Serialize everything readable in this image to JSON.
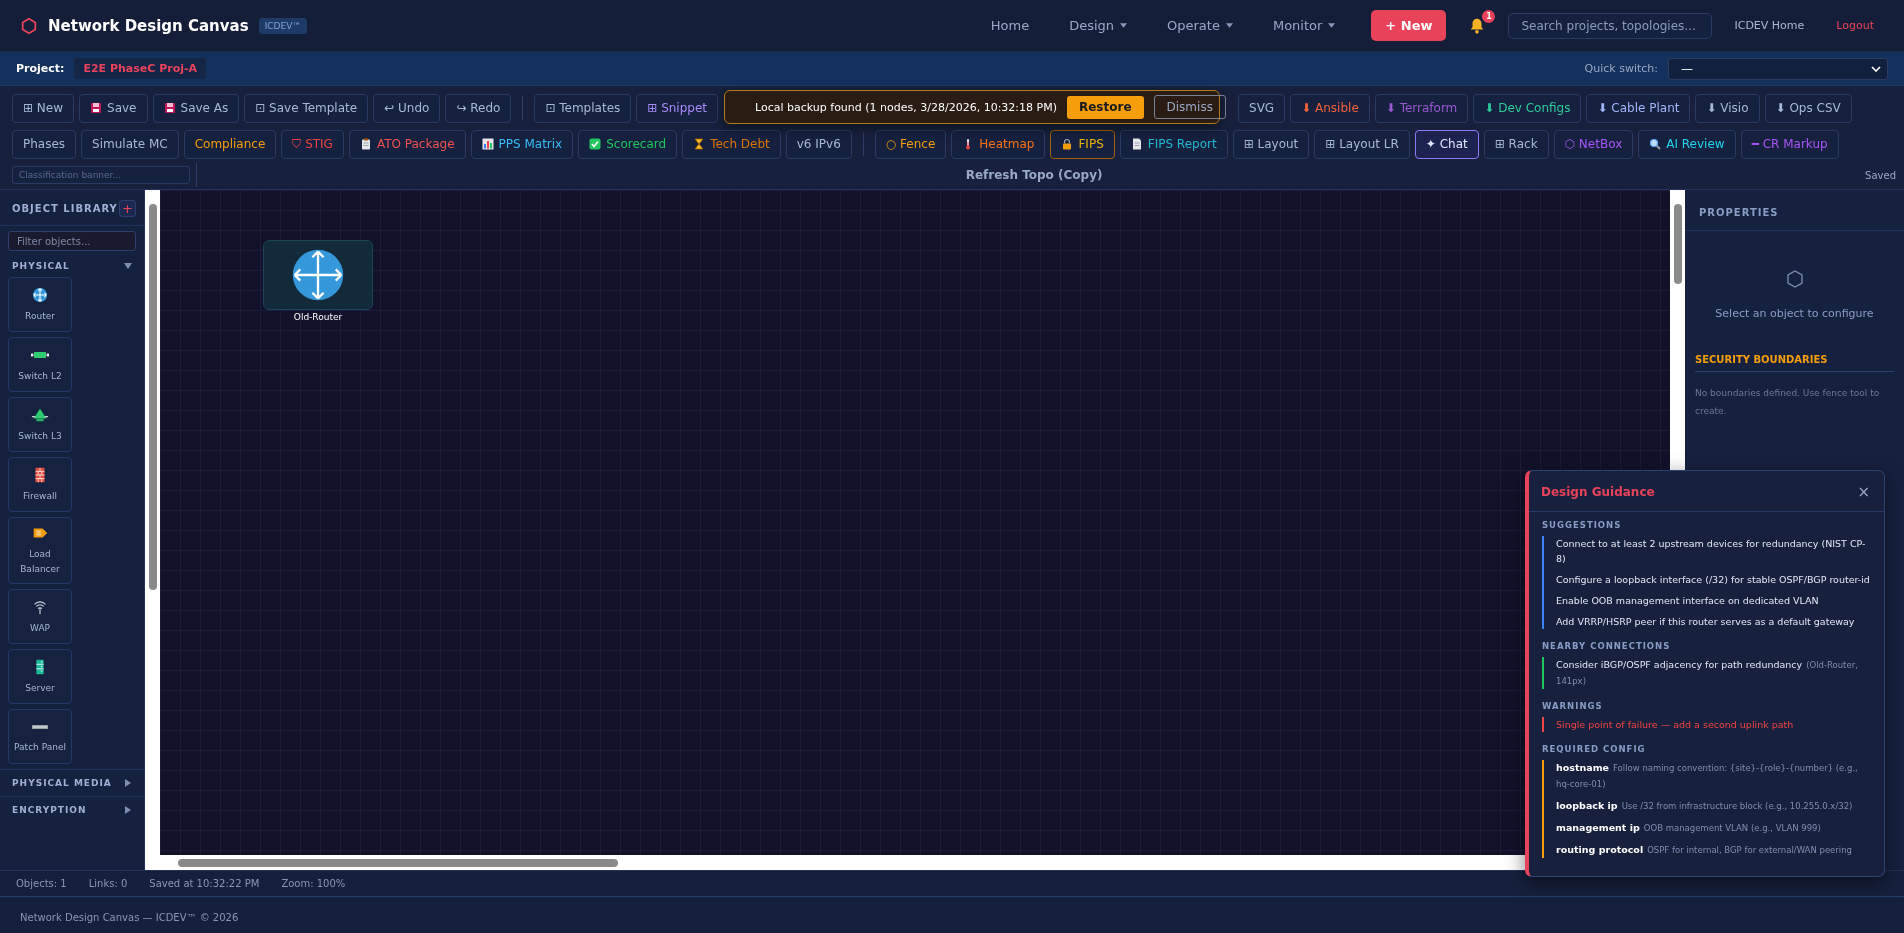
{
  "nav": {
    "logo_text": "Network Design Canvas",
    "badge": "ICDEV™",
    "menu": [
      {
        "label": "Home",
        "dropdown": false
      },
      {
        "label": "Design",
        "dropdown": true
      },
      {
        "label": "Operate",
        "dropdown": true
      },
      {
        "label": "Monitor",
        "dropdown": true
      }
    ],
    "new_button": "+ New",
    "notifications": "1",
    "search": {
      "placeholder": "Search projects, topologies..."
    },
    "home_link": "ICDEV Home",
    "logout": "Logout"
  },
  "project_bar": {
    "label": "Project:",
    "project": "E2E PhaseC Proj-A",
    "quick_switch_label": "Quick switch:",
    "quick_switch_value": "—"
  },
  "toolbar": {
    "rows": [
      {
        "groups": [
          [
            {
              "label": "⊞ New",
              "color": "#a9b8d6"
            },
            {
              "label": "Save",
              "kind": "disk",
              "color": "#a9b8d6"
            },
            {
              "label": "Save As",
              "kind": "disk",
              "color": "#a9b8d6"
            },
            {
              "label": "⊡ Save Template",
              "color": "#a9b8d6"
            },
            {
              "label": "↩ Undo",
              "color": "#a9b8d6"
            },
            {
              "label": "↪ Redo",
              "color": "#a9b8d6"
            }
          ],
          [
            {
              "label": "⊡ Templates",
              "color": "#a9b8d6"
            },
            {
              "label": "⊞ Snippet",
              "color": "#a78bfa"
            },
            {
              "kind": "hidden"
            },
            {
              "label": "SVG",
              "color": "#a9b8d6"
            },
            {
              "label": "⬇ Ansible",
              "color": "#f4623a"
            },
            {
              "label": "⬇ Terraform",
              "color": "#9b59d0"
            },
            {
              "label": "⬇ Dev Configs",
              "color": "#2ecc9a"
            },
            {
              "label": "⬇ Cable Plant",
              "color": "#a5b4fc"
            },
            {
              "label": "⬇ Visio",
              "color": "#a9b8d6"
            },
            {
              "label": "⬇ Ops CSV",
              "color": "#a9b8d6"
            }
          ]
        ]
      },
      {
        "groups": [
          [
            {
              "label": "Phases",
              "color": "#a9b8d6"
            },
            {
              "label": "Simulate MC",
              "color": "#a9b8d6"
            },
            {
              "label": "Compliance",
              "color": "#f59e0b"
            },
            {
              "label": "⛉ STIG",
              "color": "#ef4444"
            },
            {
              "label": "ATO Package",
              "kind": "clipboard",
              "color": "#f05252"
            },
            {
              "label": "PPS Matrix",
              "kind": "chart",
              "color": "#38bdf8"
            },
            {
              "label": "Scorecard",
              "kind": "check",
              "color": "#22c55e"
            },
            {
              "label": "Tech Debt",
              "kind": "hourglass",
              "color": "#d97706"
            },
            {
              "label": "v6 IPv6",
              "color": "#a9b8d6"
            }
          ],
          [
            {
              "label": "○ Fence",
              "color": "#f59e0b"
            },
            {
              "label": "Heatmap",
              "kind": "thermometer",
              "color": "#f97316"
            },
            {
              "label": "FIPS",
              "kind": "lock",
              "color": "#eab308",
              "highlight": true
            },
            {
              "label": "FIPS Report",
              "kind": "document",
              "color": "#22b8cf"
            },
            {
              "label": "⊞ Layout",
              "color": "#a9b8d6"
            },
            {
              "label": "⊞ Layout LR",
              "color": "#a9b8d6"
            },
            {
              "label": "✦ Chat",
              "color": "#e0e7ff",
              "selected": true
            },
            {
              "label": "⊞ Rack",
              "color": "#a9b8d6"
            },
            {
              "label": "⬡ NetBox",
              "color": "#a855f7"
            },
            {
              "label": "AI Review",
              "kind": "search",
              "color": "#22d3ee"
            },
            {
              "label": "━ CR Markup",
              "color": "#a855f7"
            }
          ]
        ]
      }
    ],
    "classification": {
      "placeholder": "Classification banner..."
    },
    "title": "Refresh Topo (Copy)",
    "save_state": "Saved"
  },
  "toast": {
    "message": "Local backup found (1 nodes, 3/28/2026, 10:32:18 PM)",
    "restore": "Restore",
    "dismiss": "Dismiss"
  },
  "library": {
    "title": "OBJECT LIBRARY",
    "add": "+",
    "filter": {
      "placeholder": "Filter objects..."
    },
    "sections": [
      {
        "title": "PHYSICAL",
        "expanded": true,
        "items": [
          {
            "label": "Router",
            "kind": "router"
          },
          {
            "label": "Switch L2",
            "kind": "switch2"
          },
          {
            "label": "Switch L3",
            "kind": "switch3"
          },
          {
            "label": "Firewall",
            "kind": "firewall"
          },
          {
            "label": "Load Balancer",
            "kind": "balancer"
          },
          {
            "label": "WAP",
            "kind": "wap"
          },
          {
            "label": "Server",
            "kind": "server"
          },
          {
            "label": "Patch Panel",
            "kind": "patch"
          }
        ]
      },
      {
        "title": "PHYSICAL MEDIA",
        "expanded": false
      },
      {
        "title": "ENCRYPTION",
        "expanded": false
      }
    ]
  },
  "canvas": {
    "nodes": [
      {
        "label": "Old-Router",
        "kind": "router"
      }
    ]
  },
  "properties": {
    "title": "PROPERTIES",
    "empty": "Select an object to configure",
    "boundaries_title": "SECURITY BOUNDARIES",
    "boundaries_empty": "No boundaries defined. Use fence tool to create."
  },
  "guidance": {
    "title": "Design Guidance",
    "close": "×",
    "sections": [
      {
        "title": "SUGGESTIONS",
        "kind": "suggestion",
        "items": [
          {
            "text": "Connect to at least 2 upstream devices for redundancy (NIST CP-8)"
          },
          {
            "text": "Configure a loopback interface (/32) for stable OSPF/BGP router-id"
          },
          {
            "text": "Enable OOB management interface on dedicated VLAN"
          },
          {
            "text": "Add VRRP/HSRP peer if this router serves as a default gateway"
          }
        ]
      },
      {
        "title": "NEARBY CONNECTIONS",
        "kind": "connection",
        "items": [
          {
            "text": "Consider iBGP/OSPF adjacency for path redundancy",
            "note": "(Old-Router, 141px)"
          }
        ]
      },
      {
        "title": "WARNINGS",
        "kind": "warning",
        "items": [
          {
            "text": "Single point of failure — add a second uplink path"
          }
        ]
      },
      {
        "title": "REQUIRED CONFIG",
        "kind": "config",
        "items": [
          {
            "key": "hostname",
            "note": "Follow naming convention: {site}-{role}-{number} (e.g., hq-core-01)"
          },
          {
            "key": "loopback ip",
            "note": "Use /32 from infrastructure block (e.g., 10.255.0.x/32)"
          },
          {
            "key": "management ip",
            "note": "OOB management VLAN (e.g., VLAN 999)"
          },
          {
            "key": "routing protocol",
            "note": "OSPF for internal, BGP for external/WAN peering"
          }
        ]
      }
    ]
  },
  "status_bar": {
    "objects": "Objects: 1",
    "links": "Links: 0",
    "saved": "Saved at 10:32:22 PM",
    "zoom": "Zoom: 100%"
  },
  "footer": "Network Design Canvas — ICDEV™ © 2026"
}
